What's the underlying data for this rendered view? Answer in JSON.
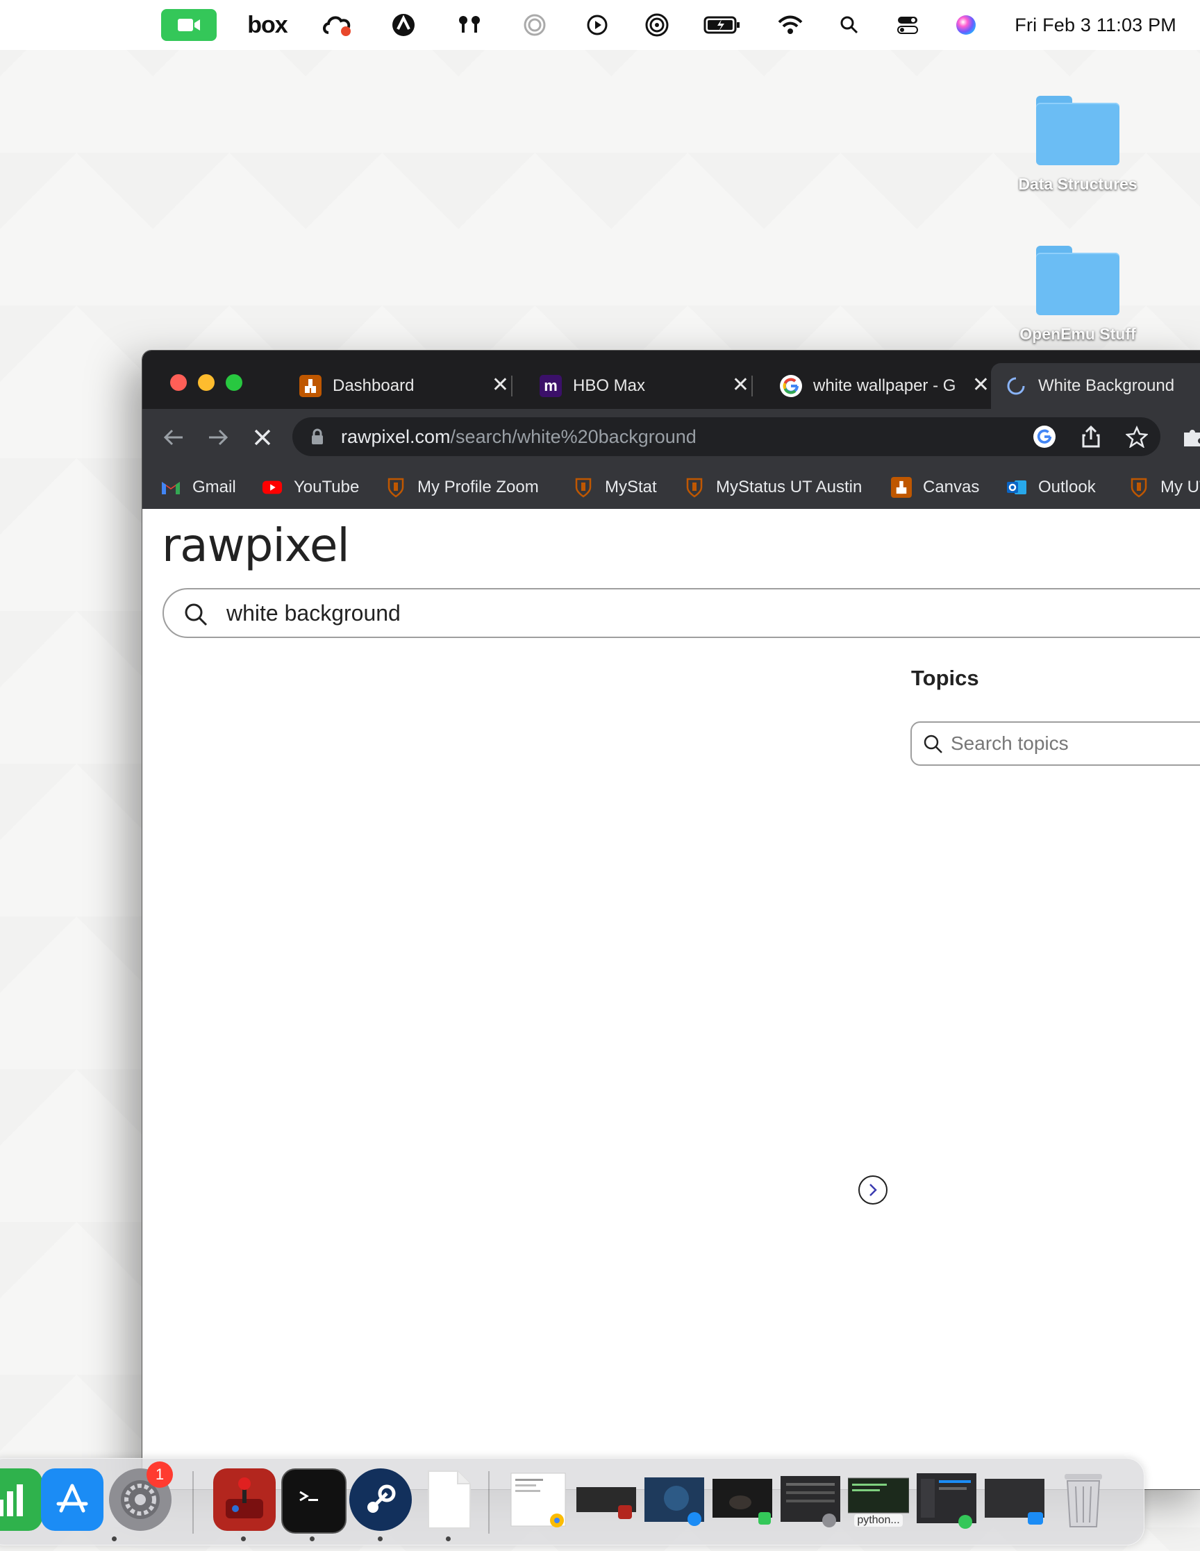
{
  "menubar": {
    "icons": [
      "facetime-camera-icon",
      "box-icon",
      "creative-cloud-icon",
      "sync-icon",
      "airpods-icon",
      "focus-icon",
      "play-icon",
      "airplay-icon",
      "battery-icon",
      "wifi-icon",
      "spotlight-icon",
      "control-center-icon",
      "siri-icon"
    ],
    "box_label": "box",
    "clock": "Fri Feb 3  11:03 PM"
  },
  "desktop": {
    "folders": [
      {
        "label": "Data Structures"
      },
      {
        "label": "OpenEmu Stuff"
      }
    ]
  },
  "browser": {
    "tabs": [
      {
        "title": "Dashboard",
        "favicon": "ut-tower-icon"
      },
      {
        "title": "HBO Max",
        "favicon": "max-icon",
        "favicon_text": "m"
      },
      {
        "title": "white wallpaper - G",
        "favicon": "google-icon"
      },
      {
        "title": "White Background",
        "favicon": "loading-spinner-icon"
      }
    ],
    "url_host": "rawpixel.com",
    "url_path": "/search/white%20background",
    "bookmarks": [
      {
        "label": "Gmail",
        "icon": "gmail-icon"
      },
      {
        "label": "YouTube",
        "icon": "youtube-icon"
      },
      {
        "label": "My Profile Zoom",
        "icon": "ut-shield-icon"
      },
      {
        "label": "MyStat",
        "icon": "ut-shield-icon"
      },
      {
        "label": "MyStatus UT Austin",
        "icon": "ut-shield-icon"
      },
      {
        "label": "Canvas",
        "icon": "ut-tower-icon"
      },
      {
        "label": "Outlook",
        "icon": "outlook-icon"
      },
      {
        "label": "My UT",
        "icon": "ut-shield-icon"
      }
    ]
  },
  "page": {
    "logo": "rawpixel",
    "search_value": "white background",
    "topics_title": "Topics",
    "topics_placeholder": "Search topics"
  },
  "dock": {
    "apps": [
      "numbers-icon",
      "app-store-icon",
      "system-settings-icon",
      "joystick-app-icon",
      "terminal-icon",
      "steam-icon",
      "document-icon"
    ],
    "settings_badge": "1",
    "window_thumb_label": "python..."
  }
}
